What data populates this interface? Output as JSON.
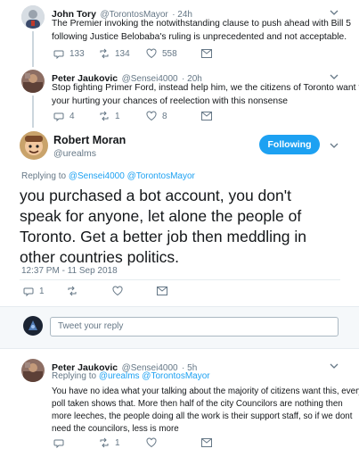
{
  "tweets": [
    {
      "name": "John Tory",
      "handle": "@TorontosMayor",
      "time": "· 24h",
      "text_line1": "The Premier invoking the notwithstanding clause to push ahead with Bill 5",
      "text_line2": "following Justice Belobaba's ruling is unprecedented and not  acceptable.",
      "replies": "133",
      "retweets": "134",
      "likes": "558"
    },
    {
      "name": "Peter Jaukovic",
      "handle": "@Sensei4000",
      "time": "· 20h",
      "text_line1": "Stop fighting Primer Ford, instead help him, we the citizens of Toronto want this,",
      "text_line2": "your hurting your chances of reelection with this nonsense",
      "replies": "4",
      "retweets": "1",
      "likes": "8"
    }
  ],
  "main_tweet": {
    "name": "Robert Moran",
    "handle": "@urealms",
    "follow_label": "Following",
    "replying_prefix": "Replying to",
    "replying_to": "@Sensei4000 @TorontosMayor",
    "text_line1": "you purchased a bot account, you don't",
    "text_line2": "speak for anyone, let alone the people of",
    "text_line3": "Toronto. Get a better job then meddling in",
    "text_line4": "other countries politics.",
    "timestamp": "12:37 PM - 11 Sep 2018",
    "replies": "1"
  },
  "reply_composer": {
    "placeholder": "Tweet your reply"
  },
  "reply_tweet": {
    "name": "Peter Jaukovic",
    "handle": "@Sensei4000",
    "time": "· 5h",
    "replying_prefix": "Replying to",
    "replying_to": "@urealms @TorontosMayor",
    "line1": "You have no idea what your talking about the majority of citizens want this, every",
    "line2": "poll taken shows that. More then half of the city Councilors  are nothing then",
    "line3": "more leeches, the people doing all the work is their support staff, so if we dont",
    "line4": "need the councilors, less is more",
    "retweets": "1"
  },
  "colors": {
    "accent": "#1da1f2",
    "text": "#14171a",
    "muted": "#657786",
    "border": "#e6ecf0"
  },
  "icons": [
    "reply-icon",
    "retweet-icon",
    "like-icon",
    "envelope-icon",
    "chevron-down-icon"
  ]
}
